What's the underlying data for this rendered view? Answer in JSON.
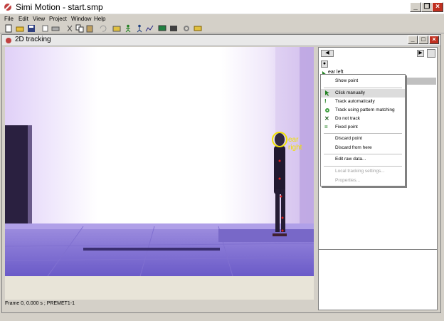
{
  "window": {
    "title": "Simi Motion - start.smp"
  },
  "menu": [
    {
      "label": "File"
    },
    {
      "label": "Edit"
    },
    {
      "label": "View"
    },
    {
      "label": "Project"
    },
    {
      "label": "Window"
    },
    {
      "label": "Help"
    }
  ],
  "child": {
    "title": "2D tracking"
  },
  "video": {
    "tracker_label": "ear right"
  },
  "status": {
    "text": "Frame 0, 0.000 s ; PREMET1-1"
  },
  "panel": {
    "tree_item": "ear left"
  },
  "context_menu": [
    {
      "label": "Show point",
      "icon": "",
      "disabled": false
    },
    {
      "label": "Click manually",
      "icon": "cursor-icon",
      "disabled": false,
      "highlighted": true
    },
    {
      "label": "Track automatically",
      "icon": "exclamation-icon",
      "disabled": false
    },
    {
      "label": "Track using pattern matching",
      "icon": "target-icon",
      "disabled": false
    },
    {
      "label": "Do not track",
      "icon": "x-icon",
      "disabled": false
    },
    {
      "label": "Fixed point",
      "icon": "equals-icon",
      "disabled": false
    },
    {
      "label": "Discard point",
      "icon": "",
      "disabled": false
    },
    {
      "label": "Discard from here",
      "icon": "",
      "disabled": false
    },
    {
      "label": "Edit raw data...",
      "icon": "",
      "disabled": false
    },
    {
      "label": "Local tracking settings...",
      "icon": "",
      "disabled": true
    },
    {
      "label": "Properties...",
      "icon": "",
      "disabled": true
    }
  ]
}
